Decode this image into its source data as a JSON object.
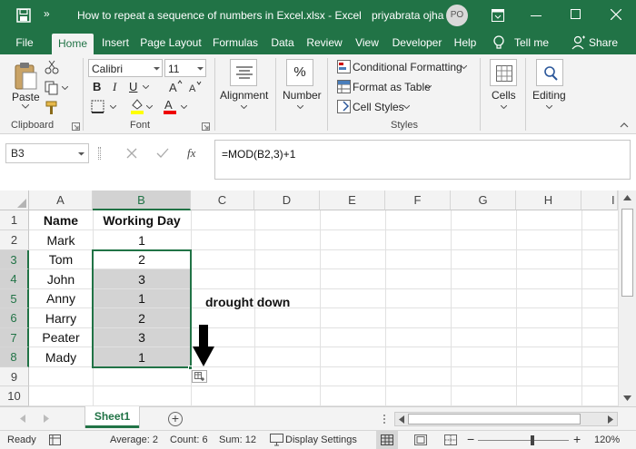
{
  "title": {
    "qat_more": "»",
    "doc_title": "How to repeat a sequence of numbers in Excel.xlsx  -  Excel",
    "user_name": "priyabrata ojha",
    "avatar_initials": "PO"
  },
  "tabs": [
    "File",
    "Home",
    "Insert",
    "Page Layout",
    "Formulas",
    "Data",
    "Review",
    "View",
    "Developer",
    "Help"
  ],
  "tell_me": "Tell me",
  "share": "Share",
  "ribbon": {
    "paste": "Paste",
    "clipboard": "Clipboard",
    "font_name": "Calibri",
    "font_size": "11",
    "bold": "B",
    "italic": "I",
    "underline": "U",
    "font_group": "Font",
    "alignment": "Alignment",
    "number": "Number",
    "percent": "%",
    "cond_fmt": "Conditional Formatting",
    "format_table": "Format as Table",
    "cell_styles": "Cell Styles",
    "styles_group": "Styles",
    "cells": "Cells",
    "editing": "Editing"
  },
  "formula_bar": {
    "name_box": "B3",
    "fx": "fx",
    "formula": "=MOD(B2,3)+1"
  },
  "columns": [
    "A",
    "B",
    "C",
    "D",
    "E",
    "F",
    "G",
    "H",
    "I"
  ],
  "rows": [
    "1",
    "2",
    "3",
    "4",
    "5",
    "6",
    "7",
    "8",
    "9",
    "10"
  ],
  "cells": {
    "a1": "Name",
    "b1": "Working Day",
    "a2": "Mark",
    "b2": "1",
    "a3": "Tom",
    "b3": "2",
    "a4": "John",
    "b4": "3",
    "a5": "Anny",
    "b5": "1",
    "a6": "Harry",
    "b6": "2",
    "a7": "Peater",
    "b7": "3",
    "a8": "Mady",
    "b8": "1"
  },
  "annotation": "drought down",
  "sheet_tab": "Sheet1",
  "add_sheet": "+",
  "status": {
    "ready": "Ready",
    "average": "Average: 2",
    "count": "Count: 6",
    "sum": "Sum: 12",
    "display_settings": "Display Settings",
    "zoom": "120%",
    "zoom_minus": "−",
    "zoom_plus": "+"
  },
  "colors": {
    "excel_green": "#217346",
    "selection_fill": "#d3d3d3"
  }
}
